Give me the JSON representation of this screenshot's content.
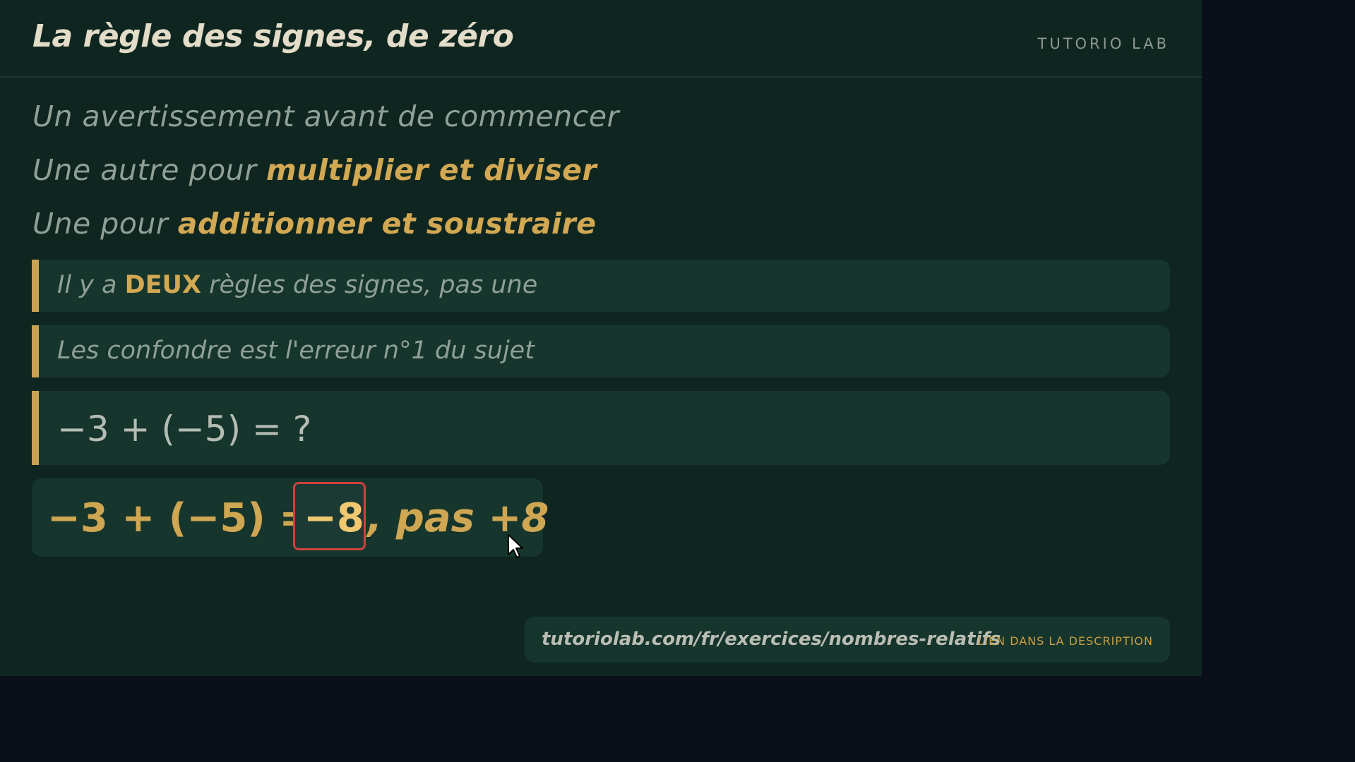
{
  "header": {
    "title": "La règle des signes, de zéro",
    "brand": "TUTORIO LAB"
  },
  "lines": {
    "line1": "Un avertissement avant de commencer",
    "line2_prefix": "Une autre pour ",
    "line2_accent": "multiplier et diviser",
    "line3_prefix": "Une pour ",
    "line3_accent": "additionner et soustraire"
  },
  "callouts": {
    "rule_prefix": "Il y a ",
    "rule_accent": "DEUX",
    "rule_suffix": " règles des signes, pas une",
    "warning": "Les confondre est l'erreur n°1 du sujet",
    "question": "−3 + (−5) = ?"
  },
  "answer": {
    "lhs": "−3 + (−5) =",
    "result": "−8",
    "rest": ", pas +8"
  },
  "footer": {
    "url": "tutoriolab.com/fr/exercices/nombres-relatifs",
    "hint": "LIEN DANS LA DESCRIPTION"
  },
  "colors": {
    "board": "#0f2620",
    "accent": "#d2a853",
    "highlight_border": "#d0413d",
    "card": "#16352c"
  },
  "icons": {
    "cursor": "mouse-pointer-icon"
  }
}
